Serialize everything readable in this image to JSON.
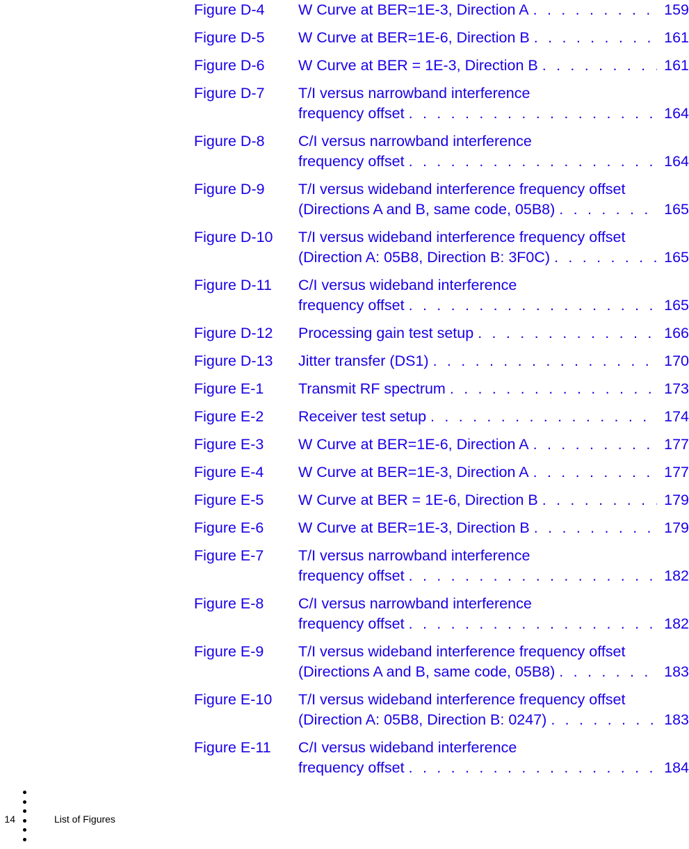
{
  "document": {
    "section_title": "List of Figures",
    "page_number": "14",
    "link_color": "#1900e6",
    "text_color": "#000000",
    "background_color": "#ffffff"
  },
  "footer": {
    "page_number": "14",
    "section_name": "List of Figures",
    "dot_count": 6
  },
  "entries": [
    {
      "label": "Figure D-4",
      "lines": [
        "W Curve at BER=1E-3, Direction A"
      ],
      "page": "159"
    },
    {
      "label": "Figure D-5",
      "lines": [
        "W Curve at BER=1E-6, Direction B"
      ],
      "page": "161"
    },
    {
      "label": "Figure D-6",
      "lines": [
        "W Curve at BER = 1E-3, Direction B"
      ],
      "page": "161"
    },
    {
      "label": "Figure D-7",
      "lines": [
        "T/I versus narrowband interference",
        "frequency offset"
      ],
      "page": "164"
    },
    {
      "label": "Figure D-8",
      "lines": [
        "C/I versus narrowband interference",
        "frequency offset"
      ],
      "page": "164"
    },
    {
      "label": "Figure D-9",
      "lines": [
        "T/I versus wideband interference frequency offset",
        "(Directions A and B, same code, 05B8)"
      ],
      "page": "165"
    },
    {
      "label": "Figure D-10",
      "lines": [
        "T/I versus wideband interference frequency offset",
        "(Direction A: 05B8, Direction B: 3F0C)"
      ],
      "page": "165"
    },
    {
      "label": "Figure D-11",
      "lines": [
        "C/I versus wideband interference",
        "frequency offset"
      ],
      "page": "165"
    },
    {
      "label": "Figure D-12",
      "lines": [
        "Processing gain test setup"
      ],
      "page": "166"
    },
    {
      "label": "Figure D-13",
      "lines": [
        "Jitter transfer (DS1)"
      ],
      "page": "170"
    },
    {
      "label": "Figure E-1",
      "lines": [
        "Transmit RF spectrum"
      ],
      "page": "173"
    },
    {
      "label": "Figure E-2",
      "lines": [
        "Receiver test setup"
      ],
      "page": "174"
    },
    {
      "label": "Figure E-3",
      "lines": [
        "W Curve at BER=1E-6, Direction A"
      ],
      "page": "177"
    },
    {
      "label": "Figure E-4",
      "lines": [
        "W Curve at BER=1E-3, Direction A"
      ],
      "page": "177"
    },
    {
      "label": "Figure E-5",
      "lines": [
        "W Curve at BER = 1E-6, Direction B"
      ],
      "page": "179"
    },
    {
      "label": "Figure E-6",
      "lines": [
        "W Curve at BER=1E-3, Direction B"
      ],
      "page": "179"
    },
    {
      "label": "Figure E-7",
      "lines": [
        "T/I versus narrowband interference",
        "frequency offset"
      ],
      "page": "182"
    },
    {
      "label": "Figure E-8",
      "lines": [
        "C/I versus narrowband interference",
        "frequency offset"
      ],
      "page": "182"
    },
    {
      "label": "Figure E-9",
      "lines": [
        "T/I versus wideband interference frequency offset",
        "(Directions A and B, same code, 05B8)"
      ],
      "page": "183"
    },
    {
      "label": "Figure E-10",
      "lines": [
        "T/I versus wideband interference frequency offset",
        "(Direction A: 05B8, Direction B: 0247)"
      ],
      "page": "183"
    },
    {
      "label": "Figure E-11",
      "lines": [
        "C/I versus wideband interference",
        "frequency offset"
      ],
      "page": "184"
    }
  ]
}
